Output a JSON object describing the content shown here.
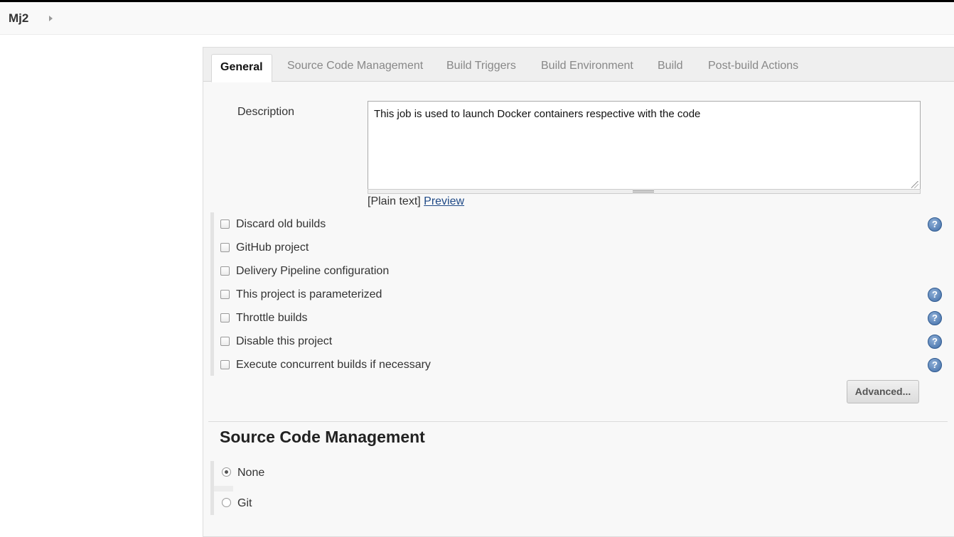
{
  "breadcrumb": {
    "title": "Mj2"
  },
  "tabs": [
    {
      "label": "General",
      "active": true
    },
    {
      "label": "Source Code Management"
    },
    {
      "label": "Build Triggers"
    },
    {
      "label": "Build Environment"
    },
    {
      "label": "Build"
    },
    {
      "label": "Post-build Actions"
    }
  ],
  "general": {
    "description_label": "Description",
    "description_value": "This job is used to launch Docker containers respective with the code",
    "plain_text": "[Plain text]",
    "preview_link": "Preview",
    "options": [
      {
        "label": "Discard old builds",
        "checked": false,
        "help": true
      },
      {
        "label": "GitHub project",
        "checked": false,
        "help": false
      },
      {
        "label": "Delivery Pipeline configuration",
        "checked": false,
        "help": false
      },
      {
        "label": "This project is parameterized",
        "checked": false,
        "help": true
      },
      {
        "label": "Throttle builds",
        "checked": false,
        "help": true
      },
      {
        "label": "Disable this project",
        "checked": false,
        "help": true
      },
      {
        "label": "Execute concurrent builds if necessary",
        "checked": false,
        "help": true
      }
    ],
    "advanced_button": "Advanced..."
  },
  "scm": {
    "heading": "Source Code Management",
    "options": [
      {
        "label": "None",
        "selected": true
      },
      {
        "label": "Git",
        "selected": false
      }
    ]
  },
  "colors": {
    "link": "#204a87",
    "help_icon": "#3f6ca6"
  }
}
